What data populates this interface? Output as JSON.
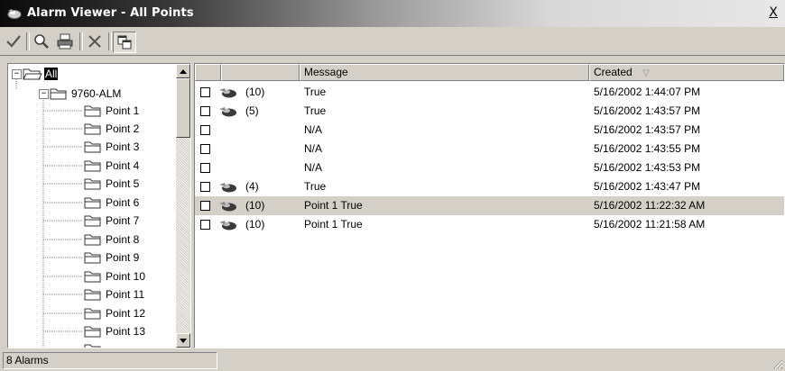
{
  "window": {
    "title": "Alarm Viewer - All Points",
    "close_label": "X"
  },
  "toolbar": {
    "buttons": [
      {
        "icon": "checkmark-icon",
        "label": "Acknowledge"
      },
      {
        "icon": "magnifier-icon",
        "label": "Find"
      },
      {
        "icon": "printer-icon",
        "label": "Print"
      },
      {
        "icon": "delete-x-icon",
        "label": "Delete"
      },
      {
        "icon": "copy-windows-icon",
        "label": "Tile"
      }
    ]
  },
  "tree": {
    "root": "All",
    "group": "9760-ALM",
    "points": [
      "Point 1",
      "Point 2",
      "Point 3",
      "Point 4",
      "Point 5",
      "Point 6",
      "Point 7",
      "Point 8",
      "Point 9",
      "Point 10",
      "Point 11",
      "Point 12",
      "Point 13"
    ]
  },
  "list": {
    "columns": [
      "",
      "",
      "Message",
      "Created"
    ],
    "sort_indicator": "▽",
    "rows": [
      {
        "has_icon": true,
        "priority": "(10)",
        "message": "True",
        "created": "5/16/2002 1:44:07 PM",
        "selected": false
      },
      {
        "has_icon": true,
        "priority": "(5)",
        "message": "True",
        "created": "5/16/2002 1:43:57 PM",
        "selected": false
      },
      {
        "has_icon": false,
        "priority": "",
        "message": "N/A",
        "created": "5/16/2002 1:43:57 PM",
        "selected": false
      },
      {
        "has_icon": false,
        "priority": "",
        "message": "N/A",
        "created": "5/16/2002 1:43:55 PM",
        "selected": false
      },
      {
        "has_icon": false,
        "priority": "",
        "message": "N/A",
        "created": "5/16/2002 1:43:53 PM",
        "selected": false
      },
      {
        "has_icon": true,
        "priority": "(4)",
        "message": "True",
        "created": "5/16/2002 1:43:47 PM",
        "selected": false
      },
      {
        "has_icon": true,
        "priority": "(10)",
        "message": "Point 1 True",
        "created": "5/16/2002 11:22:32 AM",
        "selected": true
      },
      {
        "has_icon": true,
        "priority": "(10)",
        "message": "Point 1 True",
        "created": "5/16/2002 11:21:58 AM",
        "selected": false
      }
    ]
  },
  "status": {
    "text": "8 Alarms"
  },
  "colors": {
    "chrome": "#d4d0c8",
    "selected_row": "#d4d0c8"
  }
}
